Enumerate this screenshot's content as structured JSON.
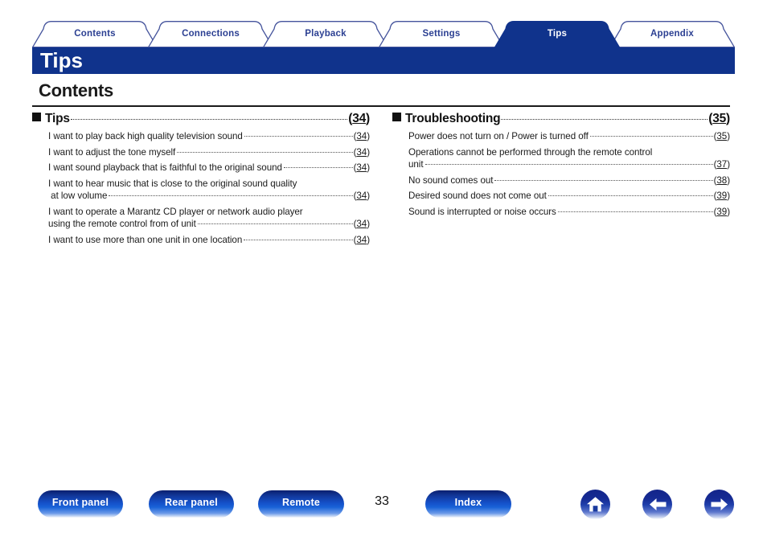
{
  "tabs": [
    {
      "label": "Contents",
      "active": false,
      "name": "tab-contents"
    },
    {
      "label": "Connections",
      "active": false,
      "name": "tab-connections"
    },
    {
      "label": "Playback",
      "active": false,
      "name": "tab-playback"
    },
    {
      "label": "Settings",
      "active": false,
      "name": "tab-settings"
    },
    {
      "label": "Tips",
      "active": true,
      "name": "tab-tips"
    },
    {
      "label": "Appendix",
      "active": false,
      "name": "tab-appendix"
    }
  ],
  "header": {
    "title": "Tips",
    "band_color": "#10338c",
    "tab_text_color": "#2b3f92",
    "tab_border_color": "#45549c"
  },
  "page": {
    "heading": "Contents",
    "footer_page_number": "33"
  },
  "toc": {
    "left": {
      "section": {
        "title": "Tips",
        "page": "34"
      },
      "entries": [
        {
          "lines": [
            "I want to play back high quality television sound"
          ],
          "page": "34"
        },
        {
          "lines": [
            "I want to adjust the tone myself"
          ],
          "page": "34"
        },
        {
          "lines": [
            "I want sound playback that is faithful to the original sound"
          ],
          "page": "34"
        },
        {
          "lines": [
            "I want to hear music that is close to the original sound quality",
            " at low volume"
          ],
          "page": "34"
        },
        {
          "lines": [
            "I want to operate a Marantz CD player or network audio player",
            "using the remote control from of unit"
          ],
          "page": "34"
        },
        {
          "lines": [
            "I want to use more than one unit in one location"
          ],
          "page": "34"
        }
      ]
    },
    "right": {
      "section": {
        "title": "Troubleshooting",
        "page": "35"
      },
      "entries": [
        {
          "lines": [
            "Power does not turn on / Power is turned off"
          ],
          "page": "35"
        },
        {
          "lines": [
            "Operations cannot be performed through the remote control",
            "unit"
          ],
          "page": "37"
        },
        {
          "lines": [
            "No sound comes out"
          ],
          "page": "38"
        },
        {
          "lines": [
            "Desired sound does not come out"
          ],
          "page": "39"
        },
        {
          "lines": [
            "Sound is interrupted or noise occurs"
          ],
          "page": "39"
        }
      ]
    }
  },
  "footer": {
    "buttons": [
      {
        "label": "Front panel",
        "name": "front-panel-button"
      },
      {
        "label": "Rear panel",
        "name": "rear-panel-button"
      },
      {
        "label": "Remote",
        "name": "remote-button"
      },
      {
        "label": "Index",
        "name": "index-button"
      }
    ],
    "icons": [
      {
        "icon": "home-icon",
        "name": "home-button"
      },
      {
        "icon": "arrow-left-icon",
        "name": "previous-page-button"
      },
      {
        "icon": "arrow-right-icon",
        "name": "next-page-button"
      }
    ]
  }
}
